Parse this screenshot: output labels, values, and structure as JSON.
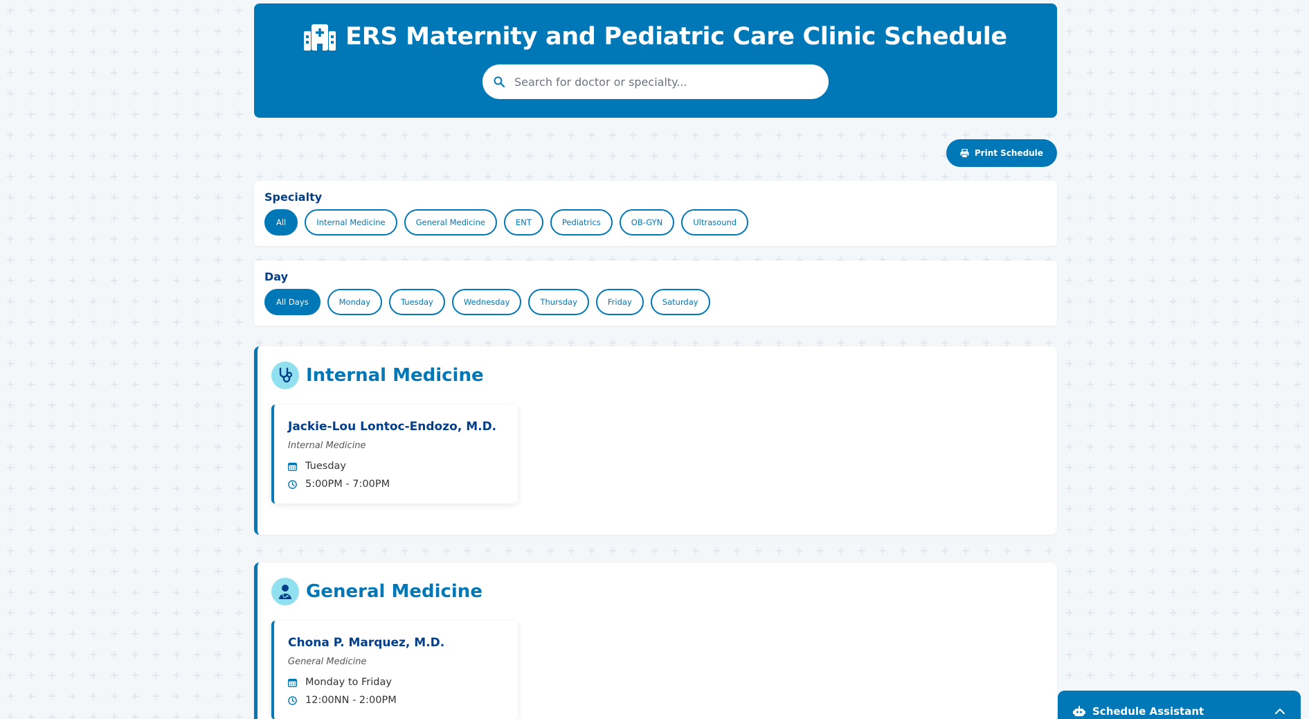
{
  "header": {
    "title": "ERS Maternity and Pediatric Care Clinic Schedule",
    "search_placeholder": "Search for doctor or specialty..."
  },
  "toolbar": {
    "print_label": "Print Schedule"
  },
  "filters": {
    "specialty": {
      "heading": "Specialty",
      "options": [
        "All",
        "Internal Medicine",
        "General Medicine",
        "ENT",
        "Pediatrics",
        "OB-GYN",
        "Ultrasound"
      ],
      "selected": "All"
    },
    "day": {
      "heading": "Day",
      "options": [
        "All Days",
        "Monday",
        "Tuesday",
        "Wednesday",
        "Thursday",
        "Friday",
        "Saturday"
      ],
      "selected": "All Days"
    }
  },
  "sections": [
    {
      "title": "Internal Medicine",
      "icon": "stethoscope-icon",
      "doctors": [
        {
          "name": "Jackie-Lou Lontoc-Endozo, M.D.",
          "specialty": "Internal Medicine",
          "days": "Tuesday",
          "hours": "5:00PM - 7:00PM"
        }
      ]
    },
    {
      "title": "General Medicine",
      "icon": "doctor-icon",
      "doctors": [
        {
          "name": "Chona P. Marquez, M.D.",
          "specialty": "General Medicine",
          "days": "Monday to Friday",
          "hours": "12:00NN - 2:00PM"
        }
      ]
    }
  ],
  "assistant": {
    "label": "Schedule Assistant"
  },
  "colors": {
    "primary": "#0077b6",
    "dark": "#023e8a",
    "light_accent": "#90e0ef"
  }
}
